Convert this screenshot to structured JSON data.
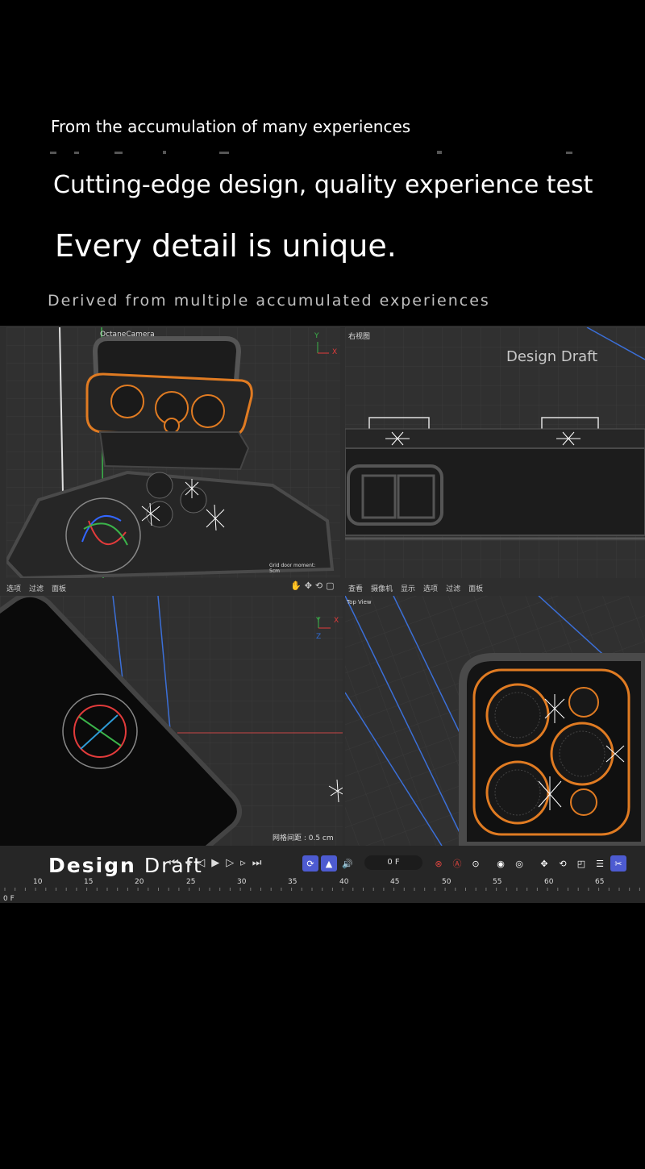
{
  "hero": {
    "line1": "From the accumulation of many experiences",
    "line2": "Cutting-edge design, quality experience test",
    "line3": "Every detail is unique.",
    "line4": "Derived from multiple accumulated experiences"
  },
  "viewports": {
    "perspective": {
      "camera_label": "OctaneCamera",
      "axis_y": "Y",
      "axis_x": "X",
      "grid_note": "Grid door moment:",
      "grid_value": "5cm"
    },
    "right": {
      "title": "右视图",
      "watermark": "Design Draft"
    },
    "front": {
      "axis_y": "Y",
      "axis_x": "X",
      "axis_z": "Z",
      "grid_spacing": "网格间距 : 0.5 cm"
    },
    "top": {
      "title": "Top View"
    }
  },
  "menus": {
    "left": [
      "选项",
      "过滤",
      "面板"
    ],
    "right": [
      "查看",
      "摄像机",
      "显示",
      "选项",
      "过滤",
      "面板"
    ]
  },
  "timeline": {
    "watermark_bold": "Design",
    "watermark_light": "Draft",
    "frame_value": "0 F",
    "frame_start": "0 F",
    "ruler_ticks": [
      "10",
      "15",
      "20",
      "25",
      "30",
      "35",
      "40",
      "45",
      "50",
      "55",
      "60",
      "65"
    ],
    "transport_icons": [
      "go-start-icon",
      "prev-key-icon",
      "prev-frame-icon",
      "play-icon",
      "next-frame-icon",
      "next-key-icon",
      "go-end-icon"
    ],
    "record_buttons": [
      "record-icon",
      "autokey-icon",
      "keyframe-icon"
    ],
    "colors": {
      "accent_blue": "#4d5bd1",
      "record_red": "#d9443f",
      "orange": "#e07b22"
    }
  }
}
